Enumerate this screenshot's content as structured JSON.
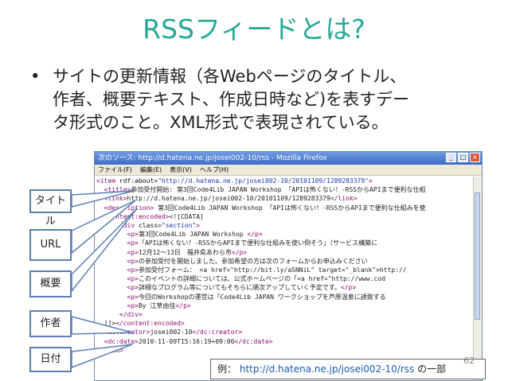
{
  "slide": {
    "title": "RSSフィードとは?",
    "bullet_symbol": "•",
    "bullet_lines": [
      "サイトの更新情報（各Webページのタイトル、",
      "作者、概要テキスト、作成日時など)を表すデー",
      "タ形式のこと。XML形式で表現されている。"
    ],
    "page_number": "62"
  },
  "window": {
    "title": "次のソース: http://d.hatena.ne.jp/josei002-10/rss - Mozilla Firefox",
    "controls": [
      "_",
      "□",
      "×"
    ],
    "menu": [
      "ファイル(F)",
      "編集(E)",
      "表示(V)",
      "ヘルプ(H)"
    ]
  },
  "source_lines": [
    {
      "indent": "",
      "tag_open": "<item",
      "attr": " rdf:about=",
      "str": "\"http://d.hatena.ne.jp/josei002-10/20101109/1289283379\"",
      "text": "",
      "tag_close": ">"
    },
    {
      "indent": "  ",
      "tag_open": "<title>",
      "attr": "",
      "str": "",
      "text": "参加受付開始: 第3回Code4Lib JAPAN Workshop 「APIは怖くない！-RSSからAPIまで便利な仕組",
      "tag_close": ""
    },
    {
      "indent": "  ",
      "tag_open": "<link>",
      "attr": "",
      "str": "",
      "text": "http://d.hatena.ne.jp/josei002-10/20101109/1289283379",
      "tag_close": "</link>"
    },
    {
      "indent": "  ",
      "tag_open": "<description>",
      "attr": "",
      "str": "",
      "text": " 第3回Code4Lib JAPAN Workshop 「APIは怖くない！-RSSからAPIまで便利な仕組みを使",
      "tag_close": ""
    },
    {
      "indent": "",
      "tag_open": "",
      "attr": "",
      "str": "",
      "text": "",
      "tag_close": ""
    },
    {
      "indent": "  ",
      "tag_open": "<content:encoded>",
      "attr": "",
      "str": "",
      "text": "<![CDATA[",
      "tag_close": ""
    },
    {
      "indent": "      ",
      "tag_open": "<div",
      "attr": " class=",
      "str": "\"section\"",
      "text": "",
      "tag_close": ">"
    },
    {
      "indent": "        ",
      "tag_open": "<p>",
      "attr": "",
      "str": "",
      "text": "第3回Code4Lib JAPAN Workshop",
      "tag_close": " </p>"
    },
    {
      "indent": "        ",
      "tag_open": "<p>",
      "attr": "",
      "str": "",
      "text": "「APIは怖くない！-RSSからAPIまで便利な仕組みを使い倒そう」（サービス構築に",
      "tag_close": ""
    },
    {
      "indent": "        ",
      "tag_open": "<p>",
      "attr": "",
      "str": "",
      "text": "12月12〜13日　福井県あわら市",
      "tag_close": "</p>"
    },
    {
      "indent": "        ",
      "tag_open": "<p>",
      "attr": "",
      "str": "",
      "text": "の参加受付を開始しました。参加希望の方は次のフォームからお申込みください",
      "tag_close": ""
    },
    {
      "indent": "        ",
      "tag_open": "<p>",
      "attr": "",
      "str": "",
      "text": "参加受付フォーム： <a href=\"http://bit.ly/aSNNiL\" target=\"_blank\">http://",
      "tag_close": ""
    },
    {
      "indent": "        ",
      "tag_open": "<p>",
      "attr": "",
      "str": "",
      "text": "このイベントの詳細については、公式ホームページの「<a href=\"http://www.cod",
      "tag_close": ""
    },
    {
      "indent": "        ",
      "tag_open": "<p>",
      "attr": "",
      "str": "",
      "text": "詳細なプログラム等についてもそちらに順次アップしていく予定です。",
      "tag_close": "</p>"
    },
    {
      "indent": "        ",
      "tag_open": "<p>",
      "attr": "",
      "str": "",
      "text": "今回のWorkshopの運営は「Code4Lib JAPAN ワークショップを芦原温泉に誘致する",
      "tag_close": ""
    },
    {
      "indent": "        ",
      "tag_open": "<p>",
      "attr": "",
      "str": "",
      "text": "By 江草由佳",
      "tag_close": "</p>"
    },
    {
      "indent": "      ",
      "tag_open": "</div>",
      "attr": "",
      "str": "",
      "text": "",
      "tag_close": ""
    },
    {
      "indent": "  ",
      "tag_open": "",
      "attr": "",
      "str": "",
      "text": "]]>",
      "tag_close": "</content:encoded>"
    },
    {
      "indent": "  ",
      "tag_open": "<dc:creator>",
      "attr": "",
      "str": "",
      "text": "josei002-10",
      "tag_close": "</dc:creator>"
    },
    {
      "indent": "  ",
      "tag_open": "<dc:date>",
      "attr": "",
      "str": "",
      "text": "2010-11-09T15:16:19+09:00",
      "tag_close": "</dc:date>"
    },
    {
      "indent": "",
      "tag_open": "</item>",
      "attr": "",
      "str": "",
      "text": "",
      "tag_close": ""
    }
  ],
  "callouts": {
    "title": "タイトル",
    "url": "URL",
    "summary": "概要",
    "author": "作者",
    "date": "日付"
  },
  "caption": {
    "prefix": "例：",
    "url": "http://d.hatena.ne.jp/josei002-10/rss",
    "suffix": " の一部"
  },
  "colors": {
    "title": "#27a896",
    "callout_border": "#5a7fb0",
    "tag": "#8b0d6e",
    "string": "#1a37a8"
  }
}
